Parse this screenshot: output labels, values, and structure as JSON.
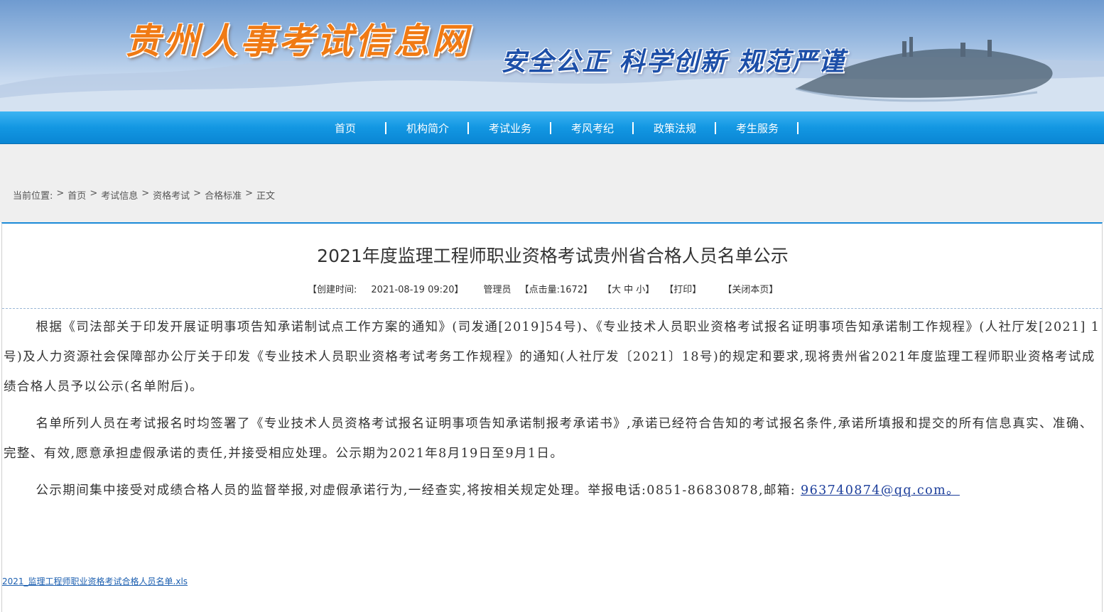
{
  "header": {
    "site_title": "贵州人事考试信息网",
    "slogan": "安全公正  科学创新  规范严谨"
  },
  "nav": {
    "items": [
      "首页",
      "机构简介",
      "考试业务",
      "考风考纪",
      "政策法规",
      "考生服务"
    ]
  },
  "breadcrumb": {
    "prefix": "当前位置:",
    "items": [
      "首页",
      "考试信息",
      "资格考试",
      "合格标准",
      "正文"
    ],
    "separator": ">"
  },
  "article": {
    "title": "2021年度监理工程师职业资格考试贵州省合格人员名单公示",
    "meta": {
      "created_label": "【创建时间:",
      "created_value": "2021-08-19 09:20】",
      "author": "管理员",
      "views": "【点击量:1672】",
      "font_size": "【大 中 小】",
      "print": "【打印】",
      "close": "【关闭本页】"
    },
    "paragraphs": [
      "根据《司法部关于印发开展证明事项告知承诺制试点工作方案的通知》(司发通[2019]54号)、《专业技术人员职业资格考试报名证明事项告知承诺制工作规程》(人社厅发[2021] 1号)及人力资源社会保障部办公厅关于印发《专业技术人员职业资格考试考务工作规程》的通知(人社厅发〔2021〕18号)的规定和要求,现将贵州省2021年度监理工程师职业资格考试成绩合格人员予以公示(名单附后)。",
      "名单所列人员在考试报名时均签署了《专业技术人员资格考试报名证明事项告知承诺制报考承诺书》,承诺已经符合告知的考试报名条件,承诺所填报和提交的所有信息真实、准确、完整、有效,愿意承担虚假承诺的责任,并接受相应处理。公示期为2021年8月19日至9月1日。"
    ],
    "last_paragraph_text": "公示期间集中接受对成绩合格人员的监督举报,对虚假承诺行为,一经查实,将按相关规定处理。举报电话:0851-86830878,邮箱: ",
    "email_link": "963740874@qq.com。",
    "attachment": "2021_监理工程师职业资格考试合格人员名单.xls"
  },
  "colors": {
    "nav_blue": "#1397e2",
    "title_orange": "#f07a14",
    "slogan_blue": "#1d4fa8",
    "link_blue": "#1b3d9a"
  }
}
